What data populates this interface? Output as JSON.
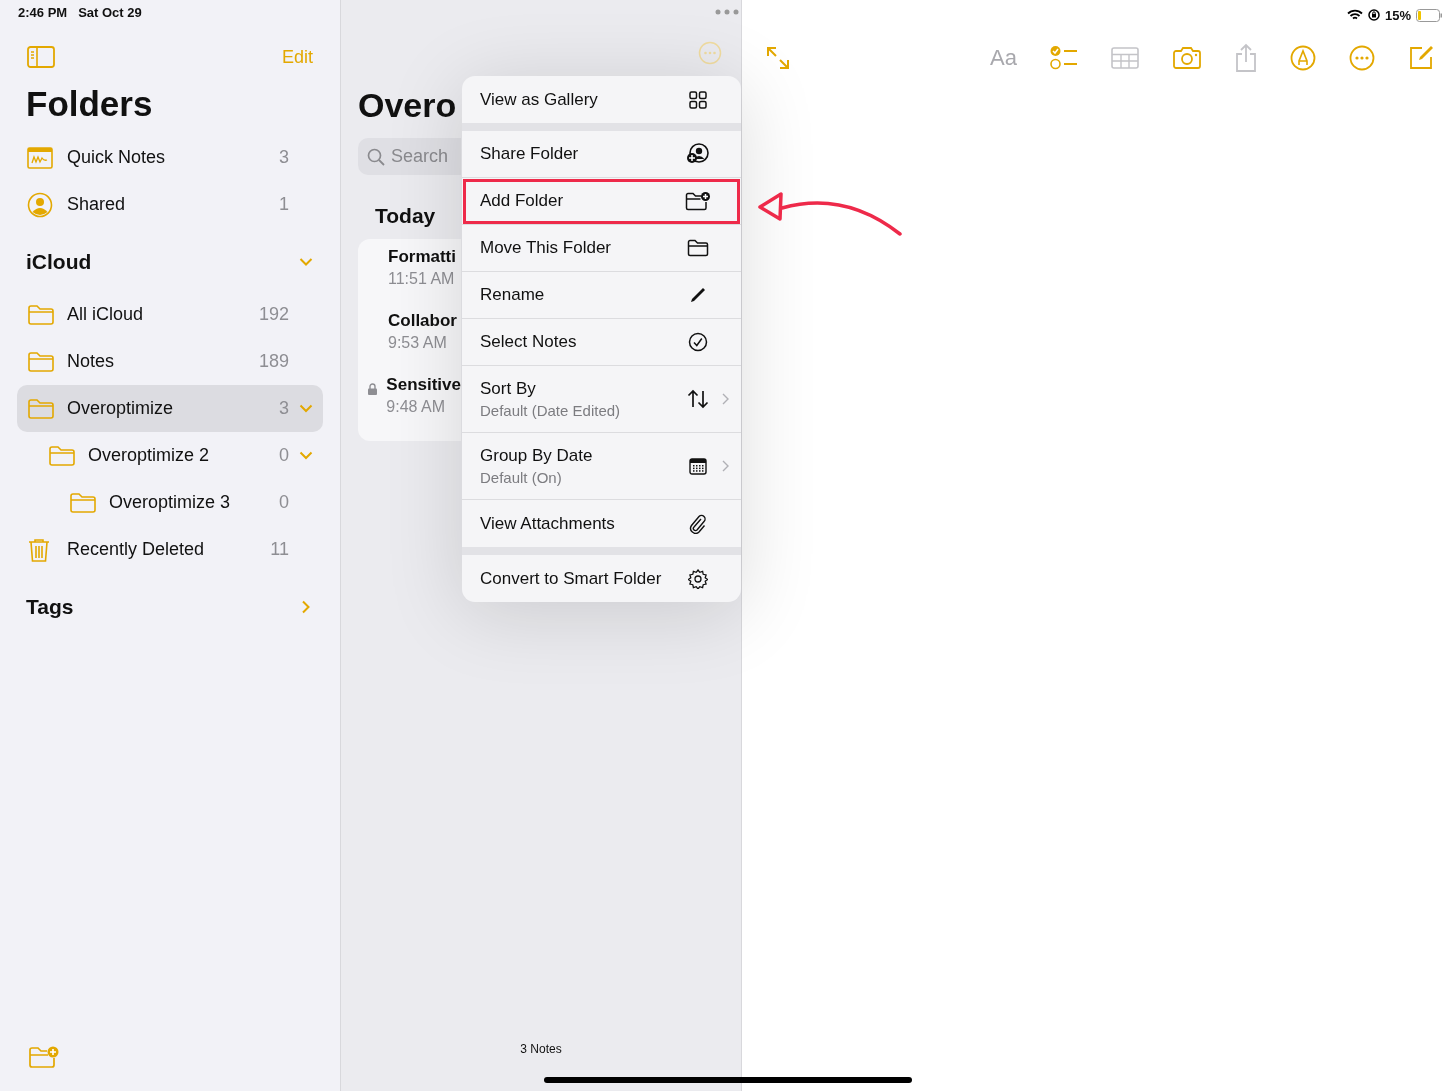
{
  "status_bar": {
    "time": "2:46 PM",
    "date": "Sat Oct 29",
    "battery": "15%"
  },
  "sidebar": {
    "edit": "Edit",
    "title": "Folders",
    "pinned": [
      {
        "kind": "quick-notes",
        "label": "Quick Notes",
        "count": "3"
      },
      {
        "kind": "shared",
        "label": "Shared",
        "count": "1"
      }
    ],
    "sections": [
      {
        "title": "iCloud",
        "expanded": true,
        "folders": [
          {
            "kind": "folder",
            "label": "All iCloud",
            "count": "192",
            "selected": false
          },
          {
            "kind": "folder",
            "label": "Notes",
            "count": "189",
            "selected": false
          },
          {
            "kind": "folder",
            "label": "Overoptimize",
            "count": "3",
            "selected": true,
            "expanded": true,
            "children": [
              {
                "kind": "folder",
                "label": "Overoptimize 2",
                "count": "0",
                "selected": false,
                "expanded": true,
                "children": [
                  {
                    "kind": "folder",
                    "label": "Overoptimize 3",
                    "count": "0",
                    "selected": false
                  }
                ]
              }
            ]
          },
          {
            "kind": "trash",
            "label": "Recently Deleted",
            "count": "11",
            "selected": false
          }
        ]
      },
      {
        "title": "Tags",
        "expanded": false
      }
    ]
  },
  "note_list": {
    "title": "Overo",
    "search": {
      "placeholder": "Search"
    },
    "section": "Today",
    "notes": [
      {
        "title": "Formatti",
        "time": "11:51 AM",
        "locked": false
      },
      {
        "title": "Collabor",
        "time": "9:53 AM",
        "locked": false
      },
      {
        "title": "Sensitive",
        "time": "9:48 AM",
        "locked": true
      }
    ],
    "footer": "3 Notes"
  },
  "menu": {
    "groups": [
      [
        {
          "label": "View as Gallery",
          "kind": "gallery",
          "chevron": false,
          "highlighted": false
        }
      ],
      [
        {
          "label": "Share Folder",
          "kind": "share-folder",
          "chevron": false,
          "highlighted": false
        },
        {
          "label": "Add Folder",
          "kind": "add-folder",
          "chevron": false,
          "highlighted": true
        },
        {
          "label": "Move This Folder",
          "kind": "folder",
          "chevron": false,
          "highlighted": false
        },
        {
          "label": "Rename",
          "kind": "pencil",
          "chevron": false,
          "highlighted": false
        },
        {
          "label": "Select Notes",
          "kind": "checkmark",
          "chevron": false,
          "highlighted": false
        },
        {
          "label": "Sort By",
          "subtitle": "Default (Date Edited)",
          "kind": "sort",
          "chevron": true,
          "highlighted": false
        },
        {
          "label": "Group By Date",
          "subtitle": "Default (On)",
          "kind": "calendar",
          "chevron": true,
          "highlighted": false
        },
        {
          "label": "View Attachments",
          "kind": "paperclip",
          "chevron": false,
          "highlighted": false
        }
      ],
      [
        {
          "label": "Convert to Smart Folder",
          "kind": "gear",
          "chevron": false,
          "highlighted": false
        }
      ]
    ]
  },
  "toolbar": [
    {
      "kind": "expand",
      "disabled": false
    },
    {
      "kind": "format",
      "label": "Aa",
      "disabled": true
    },
    {
      "kind": "checklist",
      "disabled": false
    },
    {
      "kind": "table",
      "disabled": true
    },
    {
      "kind": "camera",
      "disabled": false
    },
    {
      "kind": "share",
      "disabled": true
    },
    {
      "kind": "markup",
      "disabled": false
    },
    {
      "kind": "more",
      "disabled": false
    },
    {
      "kind": "compose",
      "disabled": false
    }
  ]
}
